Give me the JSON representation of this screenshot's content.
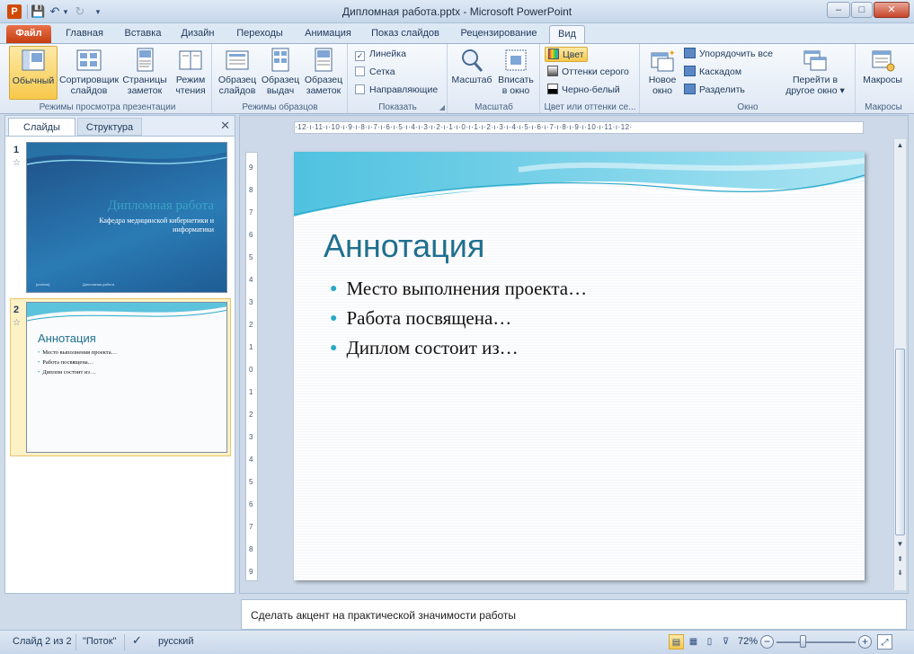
{
  "window": {
    "title": "Дипломная работа.pptx - Microsoft PowerPoint",
    "app_icon": "P",
    "buttons": [
      "–",
      "□",
      "✕"
    ]
  },
  "qat": {
    "save_icon": "💾",
    "undo_icon": "↶",
    "undo_arrow": "▾",
    "redo_icon": "↻",
    "customize_icon": "▾"
  },
  "ribbon_tabs": [
    "Файл",
    "Главная",
    "Вставка",
    "Дизайн",
    "Переходы",
    "Анимация",
    "Показ слайдов",
    "Рецензирование",
    "Вид"
  ],
  "active_tab": "Вид",
  "ribbon_help": {
    "minimize": "⌃",
    "help": "?"
  },
  "ribbon": {
    "groups": {
      "presentation_views": {
        "label": "Режимы просмотра презентации",
        "buttons": [
          "Обычный",
          "Сортировщик слайдов",
          "Страницы заметок",
          "Режим чтения"
        ]
      },
      "master_views": {
        "label": "Режимы образцов",
        "buttons": [
          "Образец слайдов",
          "Образец выдач",
          "Образец заметок"
        ]
      },
      "show": {
        "label": "Показать",
        "items": [
          {
            "label": "Линейка",
            "checked": true
          },
          {
            "label": "Сетка",
            "checked": false
          },
          {
            "label": "Направляющие",
            "checked": false
          }
        ]
      },
      "zoom": {
        "label": "Масштаб",
        "buttons": [
          "Масштаб",
          "Вписать в окно"
        ]
      },
      "color": {
        "label": "Цвет или оттенки се...",
        "items": [
          "Цвет",
          "Оттенки серого",
          "Черно-белый"
        ],
        "active": "Цвет"
      },
      "window": {
        "label": "Окно",
        "new_window": "Новое окно",
        "items": [
          "Упорядочить все",
          "Каскадом",
          "Разделить"
        ],
        "switch": "Перейти в другое окно"
      },
      "macros": {
        "label": "Макросы",
        "button": "Макросы"
      }
    }
  },
  "left_pane": {
    "tabs": [
      "Слайды",
      "Структура"
    ],
    "active_tab": "Слайды",
    "close": "✕",
    "thumbnails": [
      {
        "number": "1",
        "title": "Дипломная работа",
        "subtitle": "Кафедра медицинской кибернетики и информатики",
        "footer": [
          "[unclear]",
          "Дипломная работа"
        ]
      },
      {
        "number": "2",
        "title": "Аннотация",
        "bullets": [
          "Место выполнения проекта…",
          "Работа посвящена…",
          "Диплом состоит из…"
        ]
      }
    ],
    "selected": 2
  },
  "ruler": {
    "horizontal": "·12·ı·11·ı·10·ı·9·ı·8·ı·7·ı·6·ı·5·ı·4·ı·3·ı·2·ı·1·ı·0·ı·1·ı·2·ı·3·ı·4·ı·5·ı·6·ı·7·ı·8·ı·9·ı·10·ı·11·ı·12·",
    "vertical": [
      "9",
      "8",
      "7",
      "6",
      "5",
      "4",
      "3",
      "2",
      "1",
      "0",
      "1",
      "2",
      "3",
      "4",
      "5",
      "6",
      "7",
      "8",
      "9"
    ]
  },
  "slide": {
    "title": "Аннотация",
    "bullets": [
      "Место выполнения проекта…",
      "Работа посвящена…",
      "Диплом состоит из…"
    ]
  },
  "notes": {
    "text": "Сделать акцент на практической значимости работы"
  },
  "status": {
    "slide_counter": "Слайд 2 из 2",
    "theme": "\"Поток\"",
    "language": "русский",
    "zoom": "72%",
    "zoom_value": 72
  },
  "colors": {
    "accent": "#1f6f8f",
    "bullet": "#2aa8c8",
    "file_tab": "#c53d10",
    "active_button": "#f7c94b"
  }
}
